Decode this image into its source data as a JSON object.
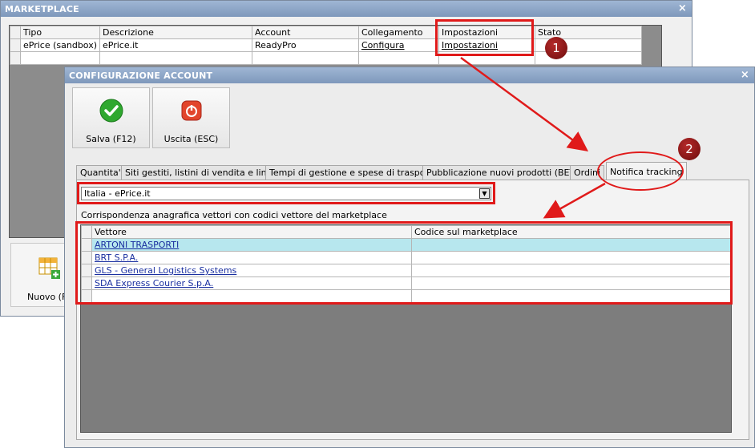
{
  "marketplace": {
    "title": "MARKETPLACE",
    "close": "×",
    "columns": [
      "Tipo",
      "Descrizione",
      "Account",
      "Collegamento",
      "Impostazioni",
      "Stato"
    ],
    "rows": [
      [
        "ePrice (sandbox)",
        "ePrice.it",
        "ReadyPro",
        "Configura",
        "Impostazioni",
        ""
      ]
    ],
    "new_button": "Nuovo (F"
  },
  "config": {
    "title": "CONFIGURAZIONE ACCOUNT",
    "close": "×",
    "save_label": "Salva (F12)",
    "exit_label": "Uscita (ESC)",
    "tabs": [
      "Quantita'",
      "Siti gestiti, listini di vendita e lingue",
      "Tempi di gestione e spese di trasporto",
      "Pubblicazione nuovi prodotti (BETA)",
      "Ordini",
      "Notifica tracking"
    ],
    "active_tab": "Notifica tracking",
    "combo_value": "Italia - ePrice.it",
    "caption": "Corrispondenza anagrafica vettori con codici vettore del marketplace",
    "grid": {
      "columns": [
        "Vettore",
        "Codice sul marketplace"
      ],
      "rows": [
        [
          "ARTONI TRASPORTI",
          ""
        ],
        [
          "BRT S.P.A.",
          ""
        ],
        [
          "GLS - General Logistics Systems",
          ""
        ],
        [
          "SDA Express Courier S.p.A.",
          ""
        ]
      ]
    }
  },
  "annotations": {
    "badge1": "1",
    "badge2": "2",
    "color": "#e01a1a"
  }
}
